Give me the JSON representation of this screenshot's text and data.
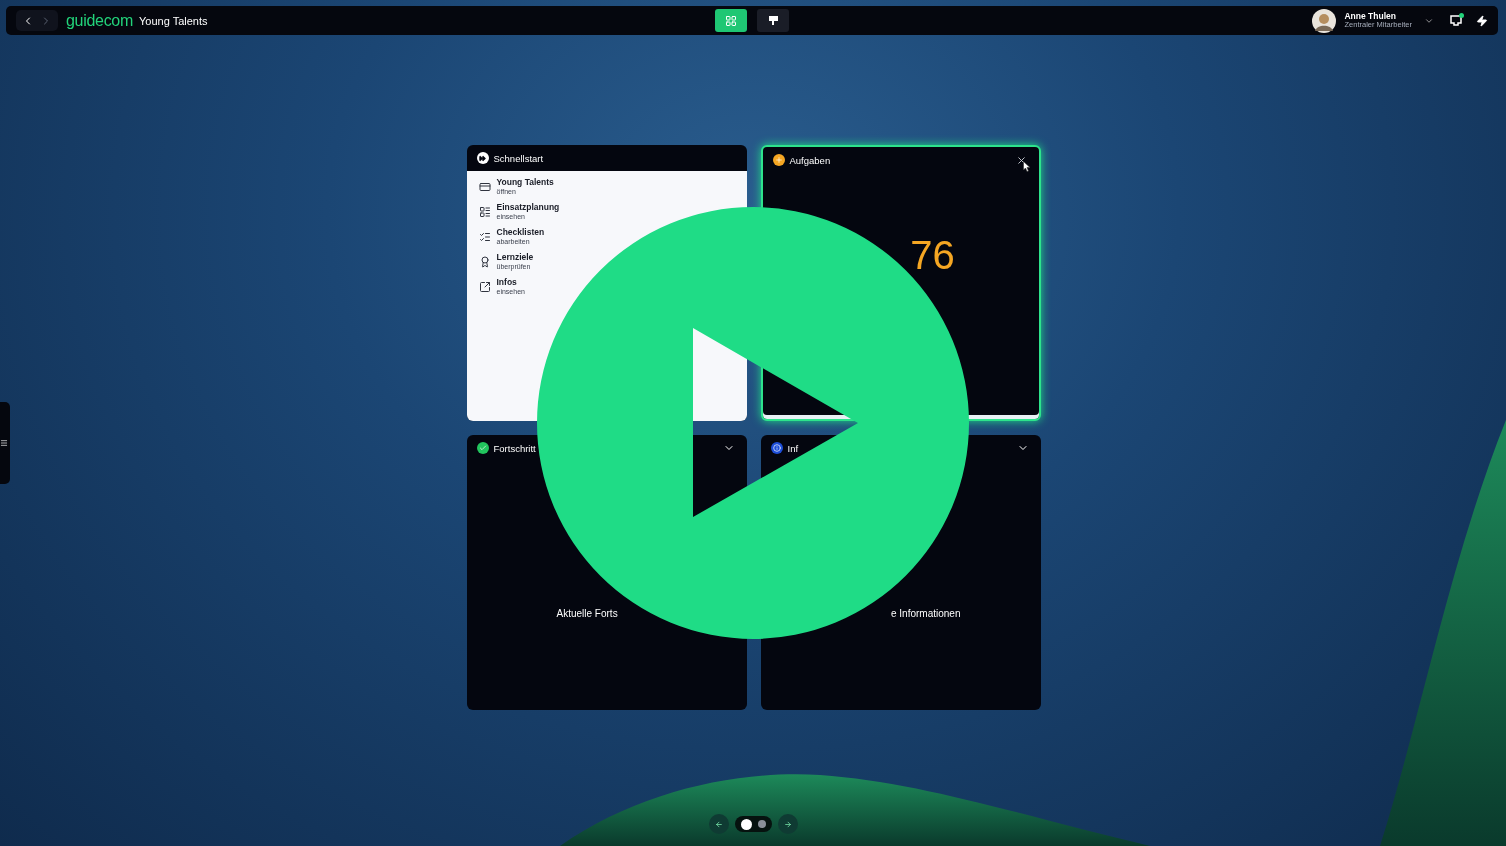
{
  "topbar": {
    "logo": "guidecom",
    "title": "Young Talents",
    "view_buttons": [
      {
        "kind": "grid",
        "selected": true
      },
      {
        "kind": "pointer",
        "selected": false
      }
    ],
    "user": {
      "name": "Anne Thulen",
      "role": "Zentraler Mitarbeiter"
    },
    "unread": true
  },
  "cards": [
    {
      "kind": "quickstart",
      "title": "Schnellstart",
      "items": [
        {
          "title": "Young Talents",
          "subtitle": "öffnen"
        },
        {
          "title": "Einsatzplanung",
          "subtitle": "einsehen"
        },
        {
          "title": "Checklisten",
          "subtitle": "abarbeiten"
        },
        {
          "title": "Lernziele",
          "subtitle": "überprüfen"
        },
        {
          "title": "Infos",
          "subtitle": "einsehen"
        }
      ]
    },
    {
      "kind": "count",
      "title": "Aufgaben",
      "value": "76",
      "highlighted": true
    },
    {
      "kind": "message",
      "title": "Fortschritt",
      "message": "Aktuelle Forts",
      "highlighted": false
    },
    {
      "kind": "message",
      "title": "Inf",
      "message": "e Informationen",
      "highlighted": false
    }
  ],
  "pager": {
    "dots": [
      {
        "selected": true
      },
      {
        "selected": false
      }
    ]
  }
}
